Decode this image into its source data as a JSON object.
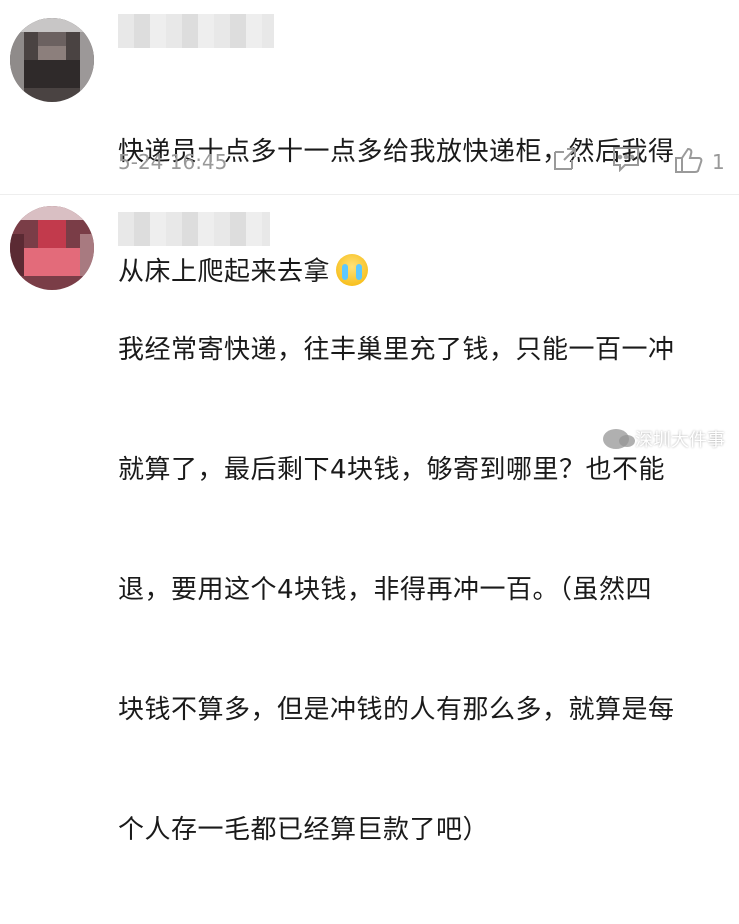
{
  "comments": [
    {
      "text_line1": "快递员十点多十一点多给我放快递柜，然后我得",
      "text_line2": "从床上爬起来去拿",
      "emoji": "crying-face-icon",
      "timestamp": "5-24 16:45",
      "like_count": "1"
    },
    {
      "lines": [
        "我经常寄快递，往丰巢里充了钱，只能一百一冲",
        "就算了，最后剩下4块钱，够寄到哪里？也不能",
        "退，要用这个4块钱，非得再冲一百。（虽然四",
        "块钱不算多，但是冲钱的人有那么多，就算是每",
        "个人存一毛都已经算巨款了吧）"
      ]
    }
  ],
  "watermark": {
    "label": "深圳大件事"
  }
}
